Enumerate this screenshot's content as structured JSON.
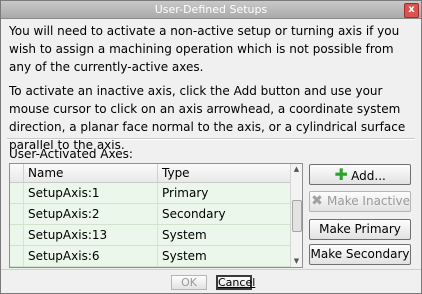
{
  "window": {
    "title": "User-Defined Setups",
    "close_symbol": "x"
  },
  "instructions": {
    "paragraph1": "You will need to activate a non-active setup or turning axis if you wish to assign a machining operation which is not possible from any of the currently-active axes.",
    "paragraph2": "To activate an inactive axis, click the Add button and use your mouse cursor to click on an axis arrowhead, a coordinate system direction, a planar face normal to the axis, or a cylindrical surface parallel to the axis."
  },
  "list": {
    "label": "User-Activated Axes:",
    "columns": [
      "",
      "Name",
      "Type"
    ],
    "rows": [
      {
        "name": "SetupAxis:1",
        "type": "Primary"
      },
      {
        "name": "SetupAxis:2",
        "type": "Secondary"
      },
      {
        "name": "SetupAxis:13",
        "type": "System"
      },
      {
        "name": "SetupAxis:6",
        "type": "System"
      }
    ],
    "row_color": "#ebf7ea"
  },
  "buttons": {
    "add": {
      "label": "Add...",
      "icon": "plus-icon",
      "icon_color": "#2ea32e",
      "enabled": true
    },
    "make_inactive": {
      "label": "Make Inactive",
      "icon": "x-icon",
      "enabled": false
    },
    "make_primary": {
      "label": "Make Primary",
      "enabled": true
    },
    "make_secondary": {
      "label": "Make Secondary",
      "enabled": true
    }
  },
  "footer": {
    "ok_label": "OK",
    "cancel_label": "Cancel"
  }
}
